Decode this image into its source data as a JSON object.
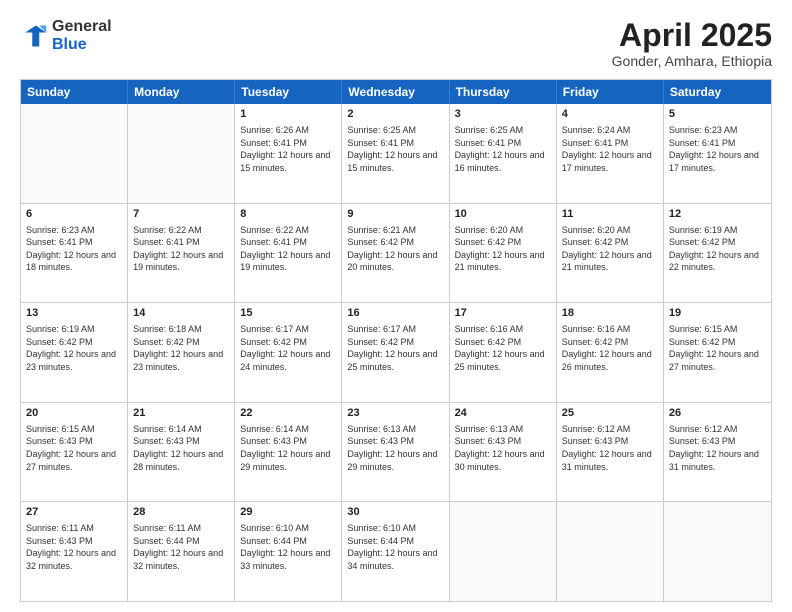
{
  "logo": {
    "general": "General",
    "blue": "Blue"
  },
  "title": "April 2025",
  "subtitle": "Gonder, Amhara, Ethiopia",
  "headers": [
    "Sunday",
    "Monday",
    "Tuesday",
    "Wednesday",
    "Thursday",
    "Friday",
    "Saturday"
  ],
  "weeks": [
    [
      {
        "day": "",
        "info": ""
      },
      {
        "day": "",
        "info": ""
      },
      {
        "day": "1",
        "info": "Sunrise: 6:26 AM\nSunset: 6:41 PM\nDaylight: 12 hours and 15 minutes."
      },
      {
        "day": "2",
        "info": "Sunrise: 6:25 AM\nSunset: 6:41 PM\nDaylight: 12 hours and 15 minutes."
      },
      {
        "day": "3",
        "info": "Sunrise: 6:25 AM\nSunset: 6:41 PM\nDaylight: 12 hours and 16 minutes."
      },
      {
        "day": "4",
        "info": "Sunrise: 6:24 AM\nSunset: 6:41 PM\nDaylight: 12 hours and 17 minutes."
      },
      {
        "day": "5",
        "info": "Sunrise: 6:23 AM\nSunset: 6:41 PM\nDaylight: 12 hours and 17 minutes."
      }
    ],
    [
      {
        "day": "6",
        "info": "Sunrise: 6:23 AM\nSunset: 6:41 PM\nDaylight: 12 hours and 18 minutes."
      },
      {
        "day": "7",
        "info": "Sunrise: 6:22 AM\nSunset: 6:41 PM\nDaylight: 12 hours and 19 minutes."
      },
      {
        "day": "8",
        "info": "Sunrise: 6:22 AM\nSunset: 6:41 PM\nDaylight: 12 hours and 19 minutes."
      },
      {
        "day": "9",
        "info": "Sunrise: 6:21 AM\nSunset: 6:42 PM\nDaylight: 12 hours and 20 minutes."
      },
      {
        "day": "10",
        "info": "Sunrise: 6:20 AM\nSunset: 6:42 PM\nDaylight: 12 hours and 21 minutes."
      },
      {
        "day": "11",
        "info": "Sunrise: 6:20 AM\nSunset: 6:42 PM\nDaylight: 12 hours and 21 minutes."
      },
      {
        "day": "12",
        "info": "Sunrise: 6:19 AM\nSunset: 6:42 PM\nDaylight: 12 hours and 22 minutes."
      }
    ],
    [
      {
        "day": "13",
        "info": "Sunrise: 6:19 AM\nSunset: 6:42 PM\nDaylight: 12 hours and 23 minutes."
      },
      {
        "day": "14",
        "info": "Sunrise: 6:18 AM\nSunset: 6:42 PM\nDaylight: 12 hours and 23 minutes."
      },
      {
        "day": "15",
        "info": "Sunrise: 6:17 AM\nSunset: 6:42 PM\nDaylight: 12 hours and 24 minutes."
      },
      {
        "day": "16",
        "info": "Sunrise: 6:17 AM\nSunset: 6:42 PM\nDaylight: 12 hours and 25 minutes."
      },
      {
        "day": "17",
        "info": "Sunrise: 6:16 AM\nSunset: 6:42 PM\nDaylight: 12 hours and 25 minutes."
      },
      {
        "day": "18",
        "info": "Sunrise: 6:16 AM\nSunset: 6:42 PM\nDaylight: 12 hours and 26 minutes."
      },
      {
        "day": "19",
        "info": "Sunrise: 6:15 AM\nSunset: 6:42 PM\nDaylight: 12 hours and 27 minutes."
      }
    ],
    [
      {
        "day": "20",
        "info": "Sunrise: 6:15 AM\nSunset: 6:43 PM\nDaylight: 12 hours and 27 minutes."
      },
      {
        "day": "21",
        "info": "Sunrise: 6:14 AM\nSunset: 6:43 PM\nDaylight: 12 hours and 28 minutes."
      },
      {
        "day": "22",
        "info": "Sunrise: 6:14 AM\nSunset: 6:43 PM\nDaylight: 12 hours and 29 minutes."
      },
      {
        "day": "23",
        "info": "Sunrise: 6:13 AM\nSunset: 6:43 PM\nDaylight: 12 hours and 29 minutes."
      },
      {
        "day": "24",
        "info": "Sunrise: 6:13 AM\nSunset: 6:43 PM\nDaylight: 12 hours and 30 minutes."
      },
      {
        "day": "25",
        "info": "Sunrise: 6:12 AM\nSunset: 6:43 PM\nDaylight: 12 hours and 31 minutes."
      },
      {
        "day": "26",
        "info": "Sunrise: 6:12 AM\nSunset: 6:43 PM\nDaylight: 12 hours and 31 minutes."
      }
    ],
    [
      {
        "day": "27",
        "info": "Sunrise: 6:11 AM\nSunset: 6:43 PM\nDaylight: 12 hours and 32 minutes."
      },
      {
        "day": "28",
        "info": "Sunrise: 6:11 AM\nSunset: 6:44 PM\nDaylight: 12 hours and 32 minutes."
      },
      {
        "day": "29",
        "info": "Sunrise: 6:10 AM\nSunset: 6:44 PM\nDaylight: 12 hours and 33 minutes."
      },
      {
        "day": "30",
        "info": "Sunrise: 6:10 AM\nSunset: 6:44 PM\nDaylight: 12 hours and 34 minutes."
      },
      {
        "day": "",
        "info": ""
      },
      {
        "day": "",
        "info": ""
      },
      {
        "day": "",
        "info": ""
      }
    ]
  ]
}
